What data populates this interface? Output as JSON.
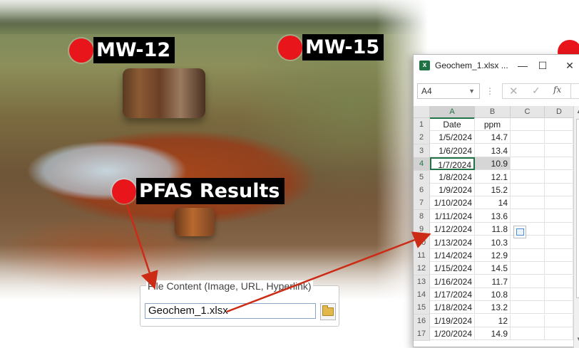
{
  "markers": [
    {
      "label": "MW-12"
    },
    {
      "label": "MW-15"
    },
    {
      "label": "PFAS Results"
    }
  ],
  "file_content": {
    "legend": "File Content (Image, URL, Hyperlink)",
    "value": "Geochem_1.xlsx"
  },
  "excel": {
    "title": "Geochem_1.xlsx ...",
    "window_controls": {
      "minimize": "—",
      "maximize": "☐",
      "close": "✕"
    },
    "name_box": "A4",
    "formula_cancel": "✕",
    "formula_enter": "✓",
    "formula_fx": "fx",
    "columns": [
      "A",
      "B",
      "C",
      "D"
    ],
    "header_row": {
      "row": "1",
      "a": "Date",
      "b": "ppm"
    },
    "rows": [
      {
        "row": "2",
        "date": "1/5/2024",
        "ppm": "14.7"
      },
      {
        "row": "3",
        "date": "1/6/2024",
        "ppm": "13.4"
      },
      {
        "row": "4",
        "date": "1/7/2024",
        "ppm": "10.9"
      },
      {
        "row": "5",
        "date": "1/8/2024",
        "ppm": "12.1"
      },
      {
        "row": "6",
        "date": "1/9/2024",
        "ppm": "15.2"
      },
      {
        "row": "7",
        "date": "1/10/2024",
        "ppm": "14"
      },
      {
        "row": "8",
        "date": "1/11/2024",
        "ppm": "13.6"
      },
      {
        "row": "9",
        "date": "1/12/2024",
        "ppm": "11.8"
      },
      {
        "row": "10",
        "date": "1/13/2024",
        "ppm": "10.3"
      },
      {
        "row": "11",
        "date": "1/14/2024",
        "ppm": "12.9"
      },
      {
        "row": "12",
        "date": "1/15/2024",
        "ppm": "14.5"
      },
      {
        "row": "13",
        "date": "1/16/2024",
        "ppm": "11.7"
      },
      {
        "row": "14",
        "date": "1/17/2024",
        "ppm": "10.8"
      },
      {
        "row": "15",
        "date": "1/18/2024",
        "ppm": "13.2"
      },
      {
        "row": "16",
        "date": "1/19/2024",
        "ppm": "12"
      },
      {
        "row": "17",
        "date": "1/20/2024",
        "ppm": "14.9"
      }
    ],
    "active_cell": "A4"
  },
  "colors": {
    "marker_red": "#e8161b",
    "label_bg": "#000000",
    "arrow": "#cc2b15",
    "excel_green": "#217346"
  }
}
